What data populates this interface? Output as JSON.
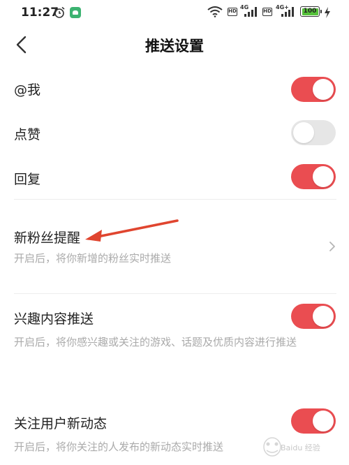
{
  "status_bar": {
    "time": "11:27",
    "icons": [
      "alarm-icon",
      "app-notification-icon",
      "wifi-icon",
      "hd-icon",
      "signal-icon",
      "battery-icon",
      "charging-icon"
    ],
    "hd_label": "HD",
    "network_1": "4G",
    "network_2": "4G+",
    "battery_level": "100"
  },
  "header": {
    "back_icon": "chevron-left-icon",
    "title": "推送设置"
  },
  "settings": {
    "mention": {
      "label": "@我",
      "enabled": true
    },
    "like": {
      "label": "点赞",
      "enabled": false
    },
    "reply": {
      "label": "回复",
      "enabled": true
    },
    "new_fans": {
      "label": "新粉丝提醒",
      "description": "开启后，将你新增的粉丝实时推送",
      "icon": "chevron-right-icon"
    },
    "interest": {
      "label": "兴趣内容推送",
      "description": "开启后，将你感兴趣或关注的游戏、话题及优质内容进行推送",
      "enabled": true
    },
    "following": {
      "label": "关注用户新动态",
      "description": "开启后，将你关注的人发布的新动态实时推送",
      "enabled": true
    }
  },
  "colors": {
    "toggle_on": "#ea4d51",
    "toggle_off": "#e6e6e6",
    "annotation_arrow": "#e0452f"
  },
  "watermark": {
    "text": "Baidu 经验"
  }
}
